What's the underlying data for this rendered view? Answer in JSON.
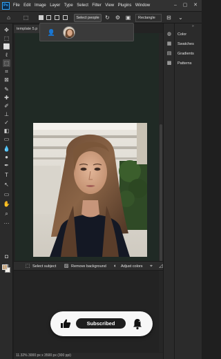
{
  "app": {
    "logo": "Ps"
  },
  "menu": [
    "File",
    "Edit",
    "Image",
    "Layer",
    "Type",
    "Select",
    "Filter",
    "View",
    "Plugins",
    "Window"
  ],
  "window_controls": {
    "minimize": "–",
    "maximize": "▢",
    "close": "✕"
  },
  "options_bar": {
    "select_subject_label": "Select people",
    "shape_mode": "Rectangle"
  },
  "document": {
    "tab_title": "template 5.p",
    "status": "11.32%   3000 px x 3500 px (300 ppi)"
  },
  "select_subject_popup": {
    "icons": [
      "people-icon",
      "portrait-avatar"
    ]
  },
  "panels": [
    {
      "label": "Color",
      "icon": "color-wheel-icon"
    },
    {
      "label": "Swatches",
      "icon": "grid-icon"
    },
    {
      "label": "Gradients",
      "icon": "gradient-icon"
    },
    {
      "label": "Patterns",
      "icon": "pattern-icon"
    }
  ],
  "taskbar": {
    "select_subject": "Select subject",
    "remove_background": "Remove background",
    "adjust_colors": "Adjust colors"
  },
  "subscribe_overlay": {
    "label": "Subscribed"
  },
  "colors": {
    "foreground": "#c7a47c",
    "background": "#f4f1ea",
    "canvas_bg": "#202a25",
    "ps_blue": "#31a8ff"
  }
}
